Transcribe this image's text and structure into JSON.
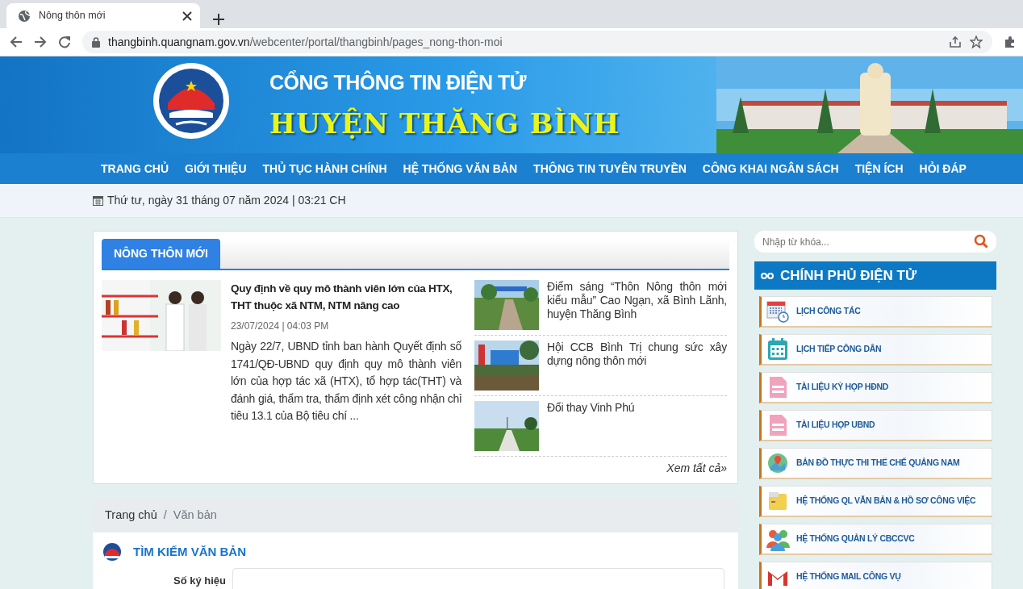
{
  "browser": {
    "tab_title": "Nông thôn mới",
    "url_host": "thangbinh.quangnam.gov.vn",
    "url_path": "/webcenter/portal/thangbinh/pages_nong-thon-moi"
  },
  "banner": {
    "title": "CỔNG THÔNG TIN ĐIỆN TỬ",
    "subtitle": "HUYỆN THĂNG BÌNH"
  },
  "nav": [
    "TRANG CHỦ",
    "GIỚI THIỆU",
    "THỦ TỤC HÀNH CHÍNH",
    "HỆ THỐNG VĂN BẢN",
    "THÔNG TIN TUYÊN TRUYỀN",
    "CÔNG KHAI NGÂN SÁCH",
    "TIỆN ÍCH",
    "HỎI ĐÁP"
  ],
  "date": "Thứ tư, ngày 31 tháng 07 năm 2024 | 03:21 CH",
  "news": {
    "heading": "NÔNG THÔN MỚI",
    "featured": {
      "title": "Quy định về quy mô thành viên lớn của HTX, THT thuộc xã NTM, NTM nâng cao",
      "date": "23/07/2024 | 04:03 PM",
      "summary": "Ngày 22/7, UBND tỉnh ban hành Quyết định số 1741/QĐ-UBND quy định quy mô thành viên lớn của hợp tác xã (HTX), tổ hợp tác(THT) và đánh giá, thẩm tra, thẩm định xét công nhận chỉ tiêu 13.1 của Bộ tiêu chí ..."
    },
    "items": [
      {
        "title": "Điểm sáng “Thôn Nông thôn mới kiểu mẫu” Cao Ngạn, xã Bình Lãnh, huyện Thăng Bình"
      },
      {
        "title": "Hội CCB Bình Trị chung sức xây dựng nông thôn mới"
      },
      {
        "title": "Đổi thay Vinh Phú"
      }
    ],
    "more": "Xem tất cả»"
  },
  "breadcrumb": {
    "items": [
      "Trang chủ",
      "Văn bản"
    ],
    "separator": "/"
  },
  "doc_search": {
    "heading": "TÌM KIẾM VĂN BẢN",
    "fields": [
      {
        "label": "Số ký hiệu"
      }
    ]
  },
  "sidebar": {
    "search_placeholder": "Nhập từ khóa...",
    "heading": "CHÍNH PHỦ ĐIỆN TỬ",
    "links": [
      "LỊCH CÔNG TÁC",
      "LỊCH TIẾP CÔNG DÂN",
      "TÀI LIỆU KỲ HỌP HĐND",
      "TÀI LIỆU HỌP UBND",
      "BẢN ĐỒ THỰC THI THỂ CHẾ QUẢNG NAM",
      "HỆ THỐNG QL VĂN BẢN & HỒ SƠ CÔNG VIỆC",
      "HỆ THỐNG QUẢN LÝ CBCCVC",
      "HỆ THỐNG MAIL CÔNG VỤ"
    ]
  }
}
